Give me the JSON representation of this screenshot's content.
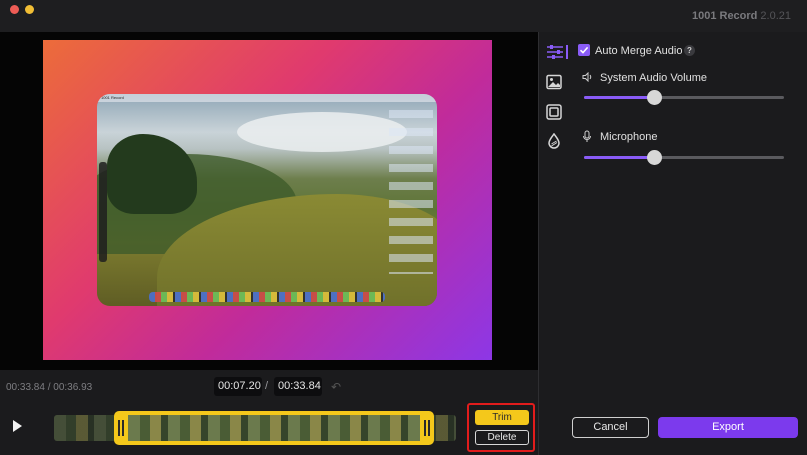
{
  "window": {
    "app_name": "1001 Record",
    "version": "2.0.21"
  },
  "preview": {
    "screen_menubar_text": "1001 Record"
  },
  "timeline": {
    "elapsed": "00:33.84 / 00:36.93",
    "trim_start": "00:07.20",
    "separator": "/",
    "trim_end": "00:33.84"
  },
  "trim_panel": {
    "trim_label": "Trim",
    "delete_label": "Delete"
  },
  "side_tabs": [
    "adjust-icon",
    "image-icon",
    "frame-icon",
    "watermark-icon"
  ],
  "audio": {
    "auto_merge_label": "Auto Merge Audio",
    "auto_merge_checked": true,
    "help_symbol": "?",
    "system_volume_label": "System Audio Volume",
    "system_volume_level": 0.35,
    "microphone_label": "Microphone",
    "microphone_level": 0.35
  },
  "footer": {
    "cancel_label": "Cancel",
    "export_label": "Export"
  },
  "colors": {
    "accent": "#8a5cf7",
    "export": "#7c3aed",
    "trim_yellow": "#f4c81b",
    "highlight_red": "#e21c1c"
  }
}
